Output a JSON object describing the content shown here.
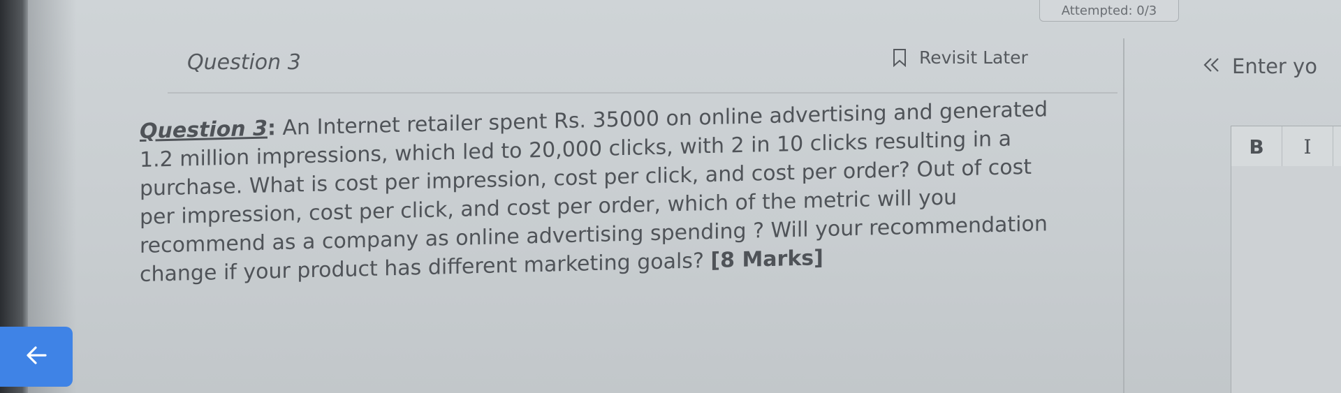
{
  "status": {
    "attempted": "Attempted: 0/3"
  },
  "question": {
    "header": "Question 3",
    "label": "Question 3",
    "label_colon": ":",
    "lines": [
      "An Internet retailer spent Rs. 35000 on online advertising and generated",
      "1.2 million impressions, which led to 20,000 clicks, with 2 in 10 clicks resulting in a",
      "purchase. What is cost per impression, cost per click, and cost per order? Out of cost",
      "per impression, cost per click, and cost per order, which of the metric will you",
      "recommend as a company as online advertising spending ? Will your recommendation",
      "change if your product has different marketing goals?"
    ],
    "marks": "[8 Marks]"
  },
  "actions": {
    "revisit_label": "Revisit Later"
  },
  "answer_panel": {
    "enter_label": "Enter yo",
    "collapse_icon": "double-chevron-left-icon",
    "toolbar": {
      "bold_label": "B",
      "italic_label": "I"
    }
  },
  "nav": {
    "back_icon": "arrow-left-icon"
  },
  "colors": {
    "accent": "#3f83e6",
    "background": "#c8cdd0",
    "text": "#4f5358"
  }
}
